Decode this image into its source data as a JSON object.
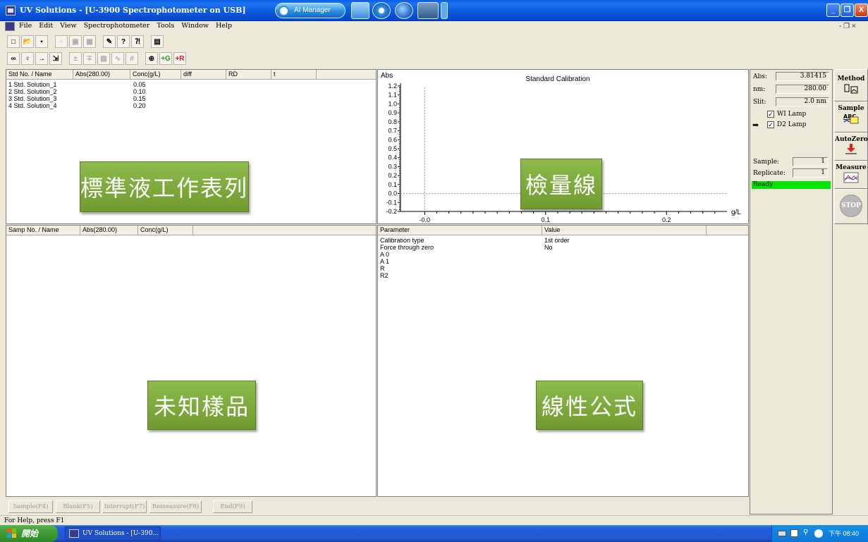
{
  "window": {
    "title": "UV Solutions - [U-3900 Spectrophotometer on USB]",
    "ai_manager_label": "AI Manager",
    "min_glyph": "_",
    "max_glyph": "❐",
    "close_glyph": "X"
  },
  "menu": {
    "items": [
      "File",
      "Edit",
      "View",
      "Spectrophotometer",
      "Tools",
      "Window",
      "Help"
    ],
    "mdi_controls": "-  ❐  ×"
  },
  "toolbar_top": [
    "new",
    "open",
    "save",
    "copy",
    "paste",
    "print",
    "properties",
    "help",
    "context-help",
    "report"
  ],
  "toolbar_bottom": [
    "connect",
    "lamp",
    "import",
    "export",
    "add",
    "delete",
    "chart",
    "fit",
    "grid",
    "scan",
    "add-green",
    "add-red"
  ],
  "toolbar_bottom_labels": {
    "green": "+G",
    "red": "+R"
  },
  "std_table": {
    "headers": [
      "Std No. / Name",
      "Abs(280.00)",
      "Conc(g/L)",
      "diff",
      "RD",
      "t"
    ],
    "rows": [
      {
        "name": "1 Std. Solution_1",
        "conc": "0.05"
      },
      {
        "name": "2 Std. Solution_2",
        "conc": "0.10"
      },
      {
        "name": "3 Std. Solution_3",
        "conc": "0.15"
      },
      {
        "name": "4 Std. Solution_4",
        "conc": "0.20"
      }
    ],
    "callout": "標準液工作表列"
  },
  "chart_data": {
    "type": "scatter",
    "title": "Standard Calibration",
    "ylabel": "Abs",
    "xlabel": "g/L",
    "ylim": [
      -0.2,
      1.2
    ],
    "xlim": [
      -0.02,
      0.25
    ],
    "yticks": [
      "1.2",
      "1.1",
      "1.0",
      "0.9",
      "0.8",
      "0.7",
      "0.6",
      "0.5",
      "0.4",
      "0.3",
      "0.2",
      "0.1",
      "0.0",
      "-0.1",
      "-0.2"
    ],
    "xticks": [
      "-0.0",
      "0.1",
      "0.2"
    ],
    "series": [],
    "callout": "檢量線"
  },
  "sample_table": {
    "headers": [
      "Samp No. / Name",
      "Abs(280.00)",
      "Conc(g/L)"
    ],
    "callout": "未知樣品"
  },
  "param_table": {
    "headers": [
      "Parameter",
      "Value"
    ],
    "rows": [
      {
        "param": "Calibration type",
        "value": "1st order"
      },
      {
        "param": "Force through zero",
        "value": "No"
      },
      {
        "param": "A 0",
        "value": ""
      },
      {
        "param": "A 1",
        "value": ""
      },
      {
        "param": "R",
        "value": ""
      },
      {
        "param": "R2",
        "value": ""
      }
    ],
    "callout": "線性公式"
  },
  "status": {
    "abs_label": "Abs:",
    "abs_value": "3.81415",
    "nm_label": "nm:",
    "nm_value": "280.00",
    "slit_label": "Slit:",
    "slit_value": "2.0 nm",
    "wi_lamp_label": "WI Lamp",
    "wi_lamp_checked": true,
    "d2_lamp_label": "D2 Lamp",
    "d2_lamp_checked": true,
    "sample_label": "Sample:",
    "sample_value": "1",
    "replicate_label": "Replicate:",
    "replicate_value": "1",
    "state": "Ready",
    "state_color": "#00e400"
  },
  "actions": {
    "method": "Method",
    "sample": "Sample",
    "sample_icon_text": "ABC",
    "autozero": "AutoZero",
    "measure": "Measure",
    "stop": "STOP"
  },
  "bottom_buttons": [
    "Sample(F4)",
    "Blank(F5)",
    "Interrupt(F7)",
    "Remeasure(F8)",
    "End(F9)"
  ],
  "statusbar": "For Help, press F1",
  "taskbar": {
    "start": "開始",
    "task": "UV Solutions - [U-390...",
    "clock": "下午 08:40"
  }
}
